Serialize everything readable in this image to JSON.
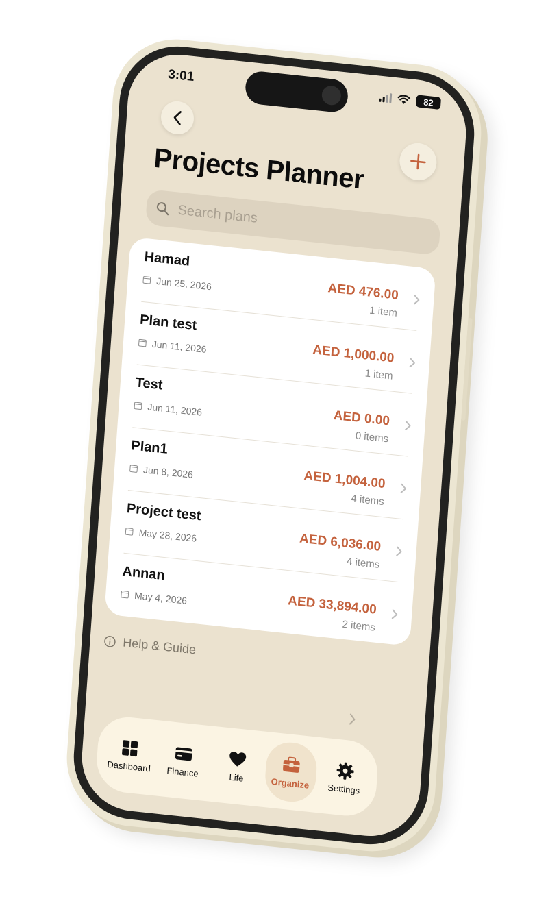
{
  "status_bar": {
    "time": "3:01",
    "battery": "82"
  },
  "header": {
    "title": "Projects Planner",
    "back_icon": "chevron-left-icon",
    "add_icon": "plus-icon"
  },
  "search": {
    "placeholder": "Search plans",
    "value": ""
  },
  "plans": [
    {
      "name": "Hamad",
      "date": "Jun 25, 2026",
      "amount": "AED 476.00",
      "items": "1 item"
    },
    {
      "name": "Plan test",
      "date": "Jun 11, 2026",
      "amount": "AED 1,000.00",
      "items": "1 item"
    },
    {
      "name": "Test",
      "date": "Jun 11, 2026",
      "amount": "AED 0.00",
      "items": "0 items"
    },
    {
      "name": "Plan1",
      "date": "Jun 8, 2026",
      "amount": "AED 1,004.00",
      "items": "4 items"
    },
    {
      "name": "Project test",
      "date": "May 28, 2026",
      "amount": "AED 6,036.00",
      "items": "4 items"
    },
    {
      "name": "Annan",
      "date": "May 4, 2026",
      "amount": "AED 33,894.00",
      "items": "2 items"
    }
  ],
  "help": {
    "label": "Help & Guide"
  },
  "tabs": [
    {
      "label": "Dashboard",
      "icon": "grid-icon",
      "active": false
    },
    {
      "label": "Finance",
      "icon": "card-icon",
      "active": false
    },
    {
      "label": "Life",
      "icon": "heart-icon",
      "active": false
    },
    {
      "label": "Organize",
      "icon": "toolbox-icon",
      "active": true
    },
    {
      "label": "Settings",
      "icon": "gear-icon",
      "active": false
    }
  ],
  "colors": {
    "accent": "#c4623d",
    "background": "#ebe2cf",
    "card": "#ffffff",
    "search_bg": "#ddd3c0"
  }
}
